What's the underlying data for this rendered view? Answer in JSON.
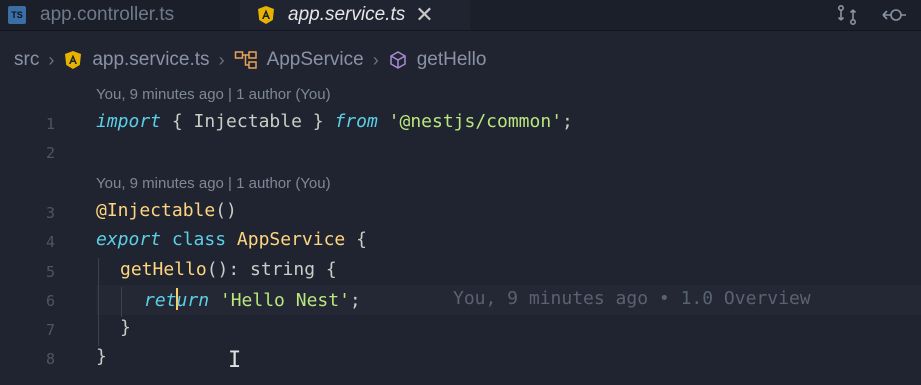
{
  "tabs": [
    {
      "badge": "TS",
      "label": "app.controller.ts"
    },
    {
      "label": "app.service.ts",
      "close": "✕"
    }
  ],
  "breadcrumb": {
    "root": "src",
    "file": "app.service.ts",
    "class": "AppService",
    "method": "getHello"
  },
  "code_lens": [
    "You, 9 minutes ago | 1 author (You)",
    "You, 9 minutes ago | 1 author (You)"
  ],
  "lines": [
    {
      "n": "1"
    },
    {
      "n": "2"
    },
    {
      "n": "3"
    },
    {
      "n": "4"
    },
    {
      "n": "5"
    },
    {
      "n": "6"
    },
    {
      "n": "7"
    },
    {
      "n": "8"
    }
  ],
  "code": {
    "l1_import": "import",
    "l1_open": " { ",
    "l1_name": "Injectable",
    "l1_close": " } ",
    "l1_from": "from",
    "l1_space": " ",
    "l1_module": "'@nestjs/common'",
    "l1_semi": ";",
    "l3_decorator": "@Injectable",
    "l3_parens": "()",
    "l4_export": "export",
    "l4_class": " class ",
    "l4_name": "AppService",
    "l4_brace": " {",
    "l5_method": "getHello",
    "l5_sig": "(): string {",
    "l6_ret_a": "ret",
    "l6_ret_b": "urn",
    "l6_space": " ",
    "l6_string": "'Hello Nest'",
    "l6_semi": ";",
    "l7_brace": "}",
    "l8_brace": "}"
  },
  "inline_blame": "You, 9 minutes ago • 1.0 Overview",
  "colors": {
    "background": "#1f2430",
    "keyword": "#5ccfe6",
    "string": "#bae67e",
    "function": "#ffd580",
    "angular": "#e8b300"
  }
}
